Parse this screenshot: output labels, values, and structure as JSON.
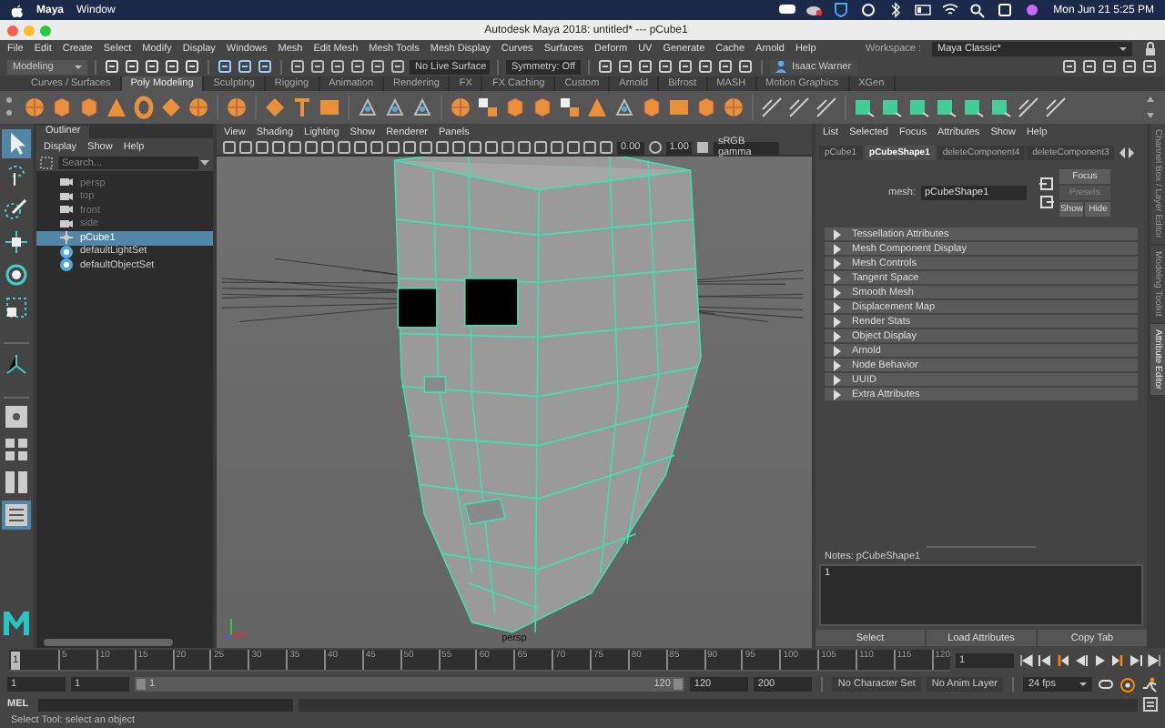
{
  "mac_menubar": {
    "app": "Maya",
    "menus": [
      "Window"
    ],
    "clock": "Mon Jun 21  5:25 PM"
  },
  "window": {
    "title": "Autodesk Maya 2018: untitled*  ---  pCube1"
  },
  "menubar": {
    "menus": [
      "File",
      "Edit",
      "Create",
      "Select",
      "Modify",
      "Display",
      "Windows",
      "Mesh",
      "Edit Mesh",
      "Mesh Tools",
      "Mesh Display",
      "Curves",
      "Surfaces",
      "Deform",
      "UV",
      "Generate",
      "Cache",
      "Arnold",
      "Help"
    ],
    "workspace_label": "Workspace :",
    "workspace": "Maya Classic*"
  },
  "status_line": {
    "menu_set": "Modeling",
    "live_surface": "No Live Surface",
    "symmetry": "Symmetry: Off",
    "user": "Isaac Warner"
  },
  "shelf_tabs": [
    {
      "label": "Curves / Surfaces",
      "selected": false
    },
    {
      "label": "Poly Modeling",
      "selected": true
    },
    {
      "label": "Sculpting",
      "selected": false
    },
    {
      "label": "Rigging",
      "selected": false
    },
    {
      "label": "Animation",
      "selected": false
    },
    {
      "label": "Rendering",
      "selected": false
    },
    {
      "label": "FX",
      "selected": false
    },
    {
      "label": "FX Caching",
      "selected": false
    },
    {
      "label": "Custom",
      "selected": false
    },
    {
      "label": "Arnold",
      "selected": false
    },
    {
      "label": "Bifrost",
      "selected": false
    },
    {
      "label": "MASH",
      "selected": false
    },
    {
      "label": "Motion Graphics",
      "selected": false
    },
    {
      "label": "XGen",
      "selected": false
    }
  ],
  "outliner": {
    "title": "Outliner",
    "menus": [
      "Display",
      "Show",
      "Help"
    ],
    "search": {
      "placeholder": "Search..."
    },
    "items": [
      {
        "label": "persp",
        "kind": "camera",
        "selected": false
      },
      {
        "label": "top",
        "kind": "camera",
        "selected": false
      },
      {
        "label": "front",
        "kind": "camera",
        "selected": false
      },
      {
        "label": "side",
        "kind": "camera",
        "selected": false
      },
      {
        "label": "pCube1",
        "kind": "mesh",
        "selected": true
      },
      {
        "label": "defaultLightSet",
        "kind": "set",
        "selected": false
      },
      {
        "label": "defaultObjectSet",
        "kind": "set",
        "selected": false
      }
    ]
  },
  "viewport": {
    "menus": [
      "View",
      "Shading",
      "Lighting",
      "Show",
      "Renderer",
      "Panels"
    ],
    "exposure": "0.00",
    "gamma": "1.00",
    "color_space": "sRGB gamma",
    "camera": "persp"
  },
  "attribute_editor": {
    "menus": [
      "List",
      "Selected",
      "Focus",
      "Attributes",
      "Show",
      "Help"
    ],
    "tabs": [
      {
        "label": "pCube1",
        "selected": false
      },
      {
        "label": "pCubeShape1",
        "selected": true
      },
      {
        "label": "deleteComponent4",
        "selected": false
      },
      {
        "label": "deleteComponent3",
        "selected": false
      }
    ],
    "node_label": "mesh:",
    "node_name": "pCubeShape1",
    "buttons": [
      {
        "label": "Focus",
        "disabled": false
      },
      {
        "label": "Presets",
        "disabled": true
      },
      {
        "label": "Show",
        "disabled": false
      },
      {
        "label": "Hide",
        "disabled": false
      }
    ],
    "sections": [
      "Tessellation Attributes",
      "Mesh Component Display",
      "Mesh Controls",
      "Tangent Space",
      "Smooth Mesh",
      "Displacement Map",
      "Render Stats",
      "Object Display",
      "Arnold",
      "Node Behavior",
      "UUID",
      "Extra Attributes"
    ],
    "notes_label": "Notes:  pCubeShape1",
    "notes": "1",
    "bottom_buttons": [
      "Select",
      "Load Attributes",
      "Copy Tab"
    ]
  },
  "side_tabs": [
    {
      "label": "Channel Box / Layer Editor",
      "selected": false
    },
    {
      "label": "Modeling Toolkit",
      "selected": false
    },
    {
      "label": "Attribute Editor",
      "selected": true
    }
  ],
  "time_slider": {
    "marker": "1",
    "ticks": [
      "5",
      "10",
      "15",
      "20",
      "25",
      "30",
      "35",
      "40",
      "45",
      "50",
      "55",
      "60",
      "65",
      "70",
      "75",
      "80",
      "85",
      "90",
      "95",
      "100",
      "105",
      "110",
      "115",
      "120"
    ],
    "current_frame": "1"
  },
  "range_slider": {
    "level": 1,
    "start": "1",
    "playback_start": "1",
    "range_start": "1",
    "range_end": "120",
    "playback_end": "120",
    "end": "200",
    "character_set": "No Character Set",
    "anim_layer": "No Anim Layer",
    "fps": "24 fps"
  },
  "command_line": {
    "label": "MEL"
  },
  "help_line": "Select Tool: select an object"
}
